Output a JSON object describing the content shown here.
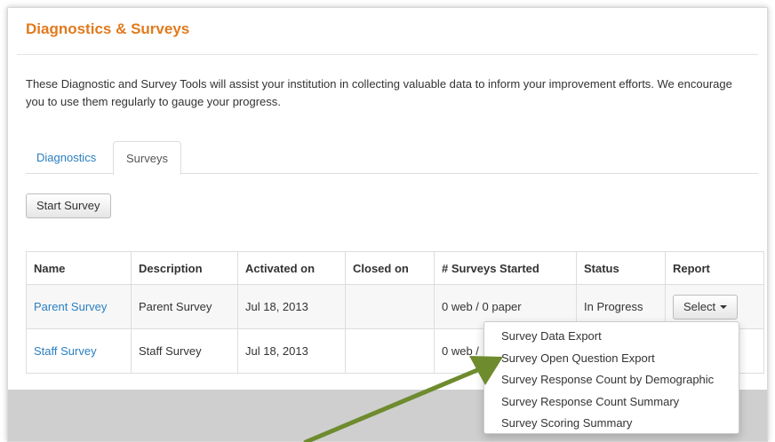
{
  "page": {
    "title": "Diagnostics & Surveys",
    "intro": "These Diagnostic and Survey Tools will assist your institution in collecting valuable data to inform your improvement efforts. We encourage you to use them regularly to gauge your progress."
  },
  "tabs": [
    {
      "label": "Diagnostics",
      "active": false
    },
    {
      "label": "Surveys",
      "active": true
    }
  ],
  "toolbar": {
    "start_survey_label": "Start Survey"
  },
  "table": {
    "headers": [
      "Name",
      "Description",
      "Activated on",
      "Closed on",
      "# Surveys Started",
      "Status",
      "Report"
    ],
    "rows": [
      {
        "name": "Parent Survey",
        "description": "Parent Survey",
        "activated_on": "Jul 18, 2013",
        "closed_on": "",
        "surveys_started": "0 web / 0 paper",
        "status": "In Progress",
        "report_label": "Select"
      },
      {
        "name": "Staff Survey",
        "description": "Staff Survey",
        "activated_on": "Jul 18, 2013",
        "closed_on": "",
        "surveys_started": "0 web /",
        "status": "",
        "report_label": ""
      }
    ]
  },
  "report_menu": {
    "items": [
      "Survey Data Export",
      "Survey Open Question Export",
      "Survey Response Count by Demographic",
      "Survey Response Count Summary",
      "Survey Scoring Summary"
    ]
  },
  "annotation": {
    "arrow_color": "#6e8b2e",
    "points_to": "Survey Open Question Export"
  },
  "colors": {
    "title": "#e07a1e",
    "link": "#2a7fc0"
  }
}
